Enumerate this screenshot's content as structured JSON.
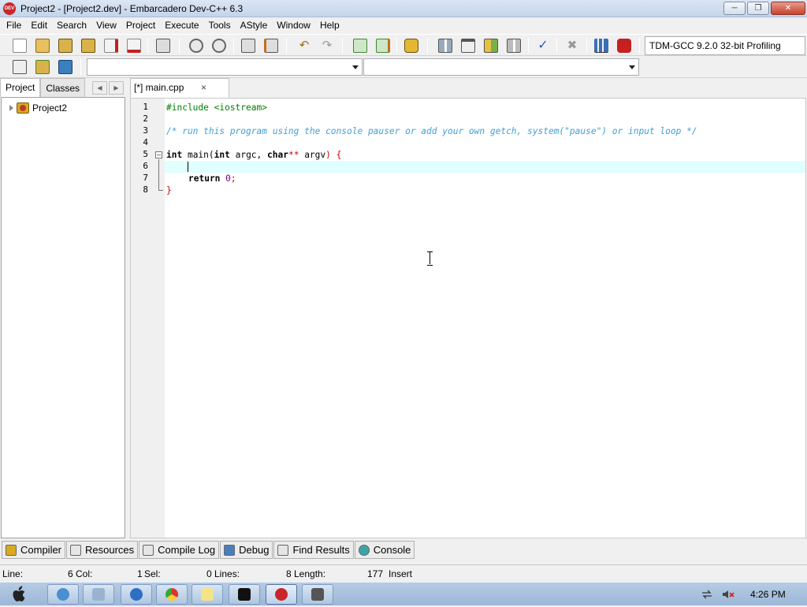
{
  "window": {
    "title": "Project2 - [Project2.dev] - Embarcadero Dev-C++ 6.3",
    "app_icon_text": "DEV",
    "minimize_icon": "minimize-icon",
    "maximize_icon": "maximize-icon",
    "close_icon": "close-icon"
  },
  "menu": [
    "File",
    "Edit",
    "Search",
    "View",
    "Project",
    "Execute",
    "Tools",
    "AStyle",
    "Window",
    "Help"
  ],
  "toolbar": {
    "compiler": "TDM-GCC 9.2.0 32-bit Profiling"
  },
  "left_panel": {
    "tabs": [
      "Project",
      "Classes"
    ],
    "tree_items": [
      "Project2"
    ]
  },
  "editor": {
    "tab_label": "[*] main.cpp",
    "tab_close": "×",
    "line_numbers": [
      "1",
      "2",
      "3",
      "4",
      "5",
      "6",
      "7",
      "8"
    ],
    "lines": {
      "l1": "#include <iostream>",
      "l3": "/* run this program using the console pauser or add your own getch, system(\"pause\") or input loop */",
      "l5_kw1": "int",
      "l5_id1": " main(",
      "l5_kw2": "int",
      "l5_id2": " argc, ",
      "l5_kw3": "char",
      "l5_sym1": "**",
      "l5_id3": " argv",
      "l5_sym2": ") {",
      "l7_kw": "return",
      "l7_num": "0",
      "l7_sym": ";",
      "l8_sym": "}"
    }
  },
  "bottom_tabs": [
    "Compiler",
    "Resources",
    "Compile Log",
    "Debug",
    "Find Results",
    "Console"
  ],
  "status": {
    "line_label": "Line:",
    "line_value": "6",
    "col_label": "Col:",
    "col_value": "1",
    "sel_label": "Sel:",
    "sel_value": "0",
    "lines_label": "Lines:",
    "lines_value": "8",
    "length_label": "Length:",
    "length_value": "177",
    "mode": "Insert"
  },
  "taskbar": {
    "clock": "4:26 PM"
  },
  "colors": {
    "current_line": "#e0ffff",
    "preprocessor": "#008000",
    "comment": "#3f9fd8",
    "symbol": "#cc0000",
    "number": "#800080"
  }
}
